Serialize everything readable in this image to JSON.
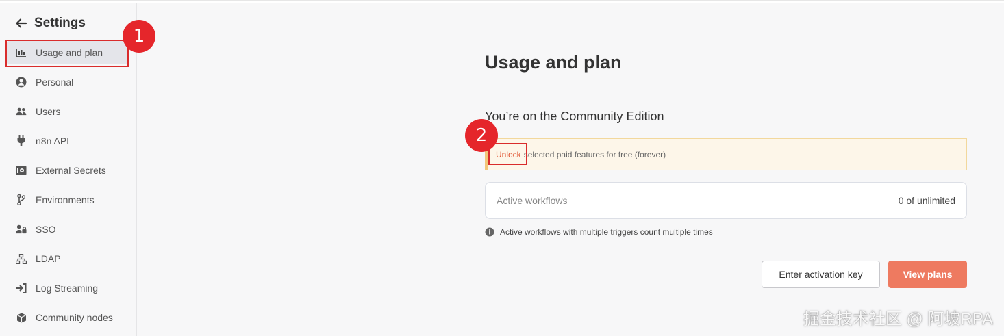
{
  "sidebar": {
    "title": "Settings",
    "items": [
      {
        "label": "Usage and plan",
        "icon": "chart-bar-icon"
      },
      {
        "label": "Personal",
        "icon": "user-circle-icon"
      },
      {
        "label": "Users",
        "icon": "users-icon"
      },
      {
        "label": "n8n API",
        "icon": "plug-icon"
      },
      {
        "label": "External Secrets",
        "icon": "vault-icon"
      },
      {
        "label": "Environments",
        "icon": "code-branch-icon"
      },
      {
        "label": "SSO",
        "icon": "user-lock-icon"
      },
      {
        "label": "LDAP",
        "icon": "network-icon"
      },
      {
        "label": "Log Streaming",
        "icon": "sign-in-icon"
      },
      {
        "label": "Community nodes",
        "icon": "cube-icon"
      }
    ]
  },
  "main": {
    "title": "Usage and plan",
    "edition": "You’re on the Community Edition",
    "callout": {
      "link": "Unlock",
      "text": "selected paid features for free (forever)"
    },
    "workflows": {
      "label": "Active workflows",
      "value": "0 of unlimited"
    },
    "info_text": "Active workflows with multiple triggers count multiple times",
    "buttons": {
      "activation": "Enter activation key",
      "plans": "View plans"
    }
  },
  "annotations": {
    "badge1": "1",
    "badge2": "2"
  },
  "watermark": "掘金技术社区 @ 阿坡RPA",
  "colors": {
    "accent": "#ee7a60",
    "highlight": "#e5262b",
    "callout_bg": "#fdf6e9"
  }
}
